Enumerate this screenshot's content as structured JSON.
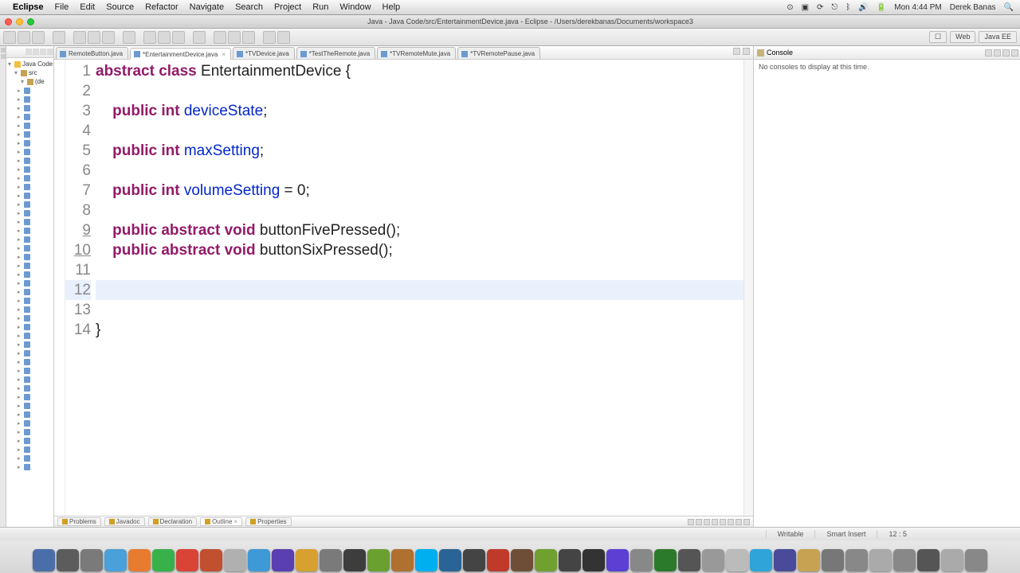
{
  "mac": {
    "app": "Eclipse",
    "menus": [
      "File",
      "Edit",
      "Source",
      "Refactor",
      "Navigate",
      "Search",
      "Project",
      "Run",
      "Window",
      "Help"
    ],
    "time": "Mon 4:44 PM",
    "user": "Derek Banas"
  },
  "window": {
    "title": "Java - Java Code/src/EntertainmentDevice.java - Eclipse - /Users/derekbanas/Documents/workspace3"
  },
  "perspectives": [
    "Web",
    "Java EE"
  ],
  "explorer": {
    "title": "Java Code",
    "pkg": "src",
    "default_pkg": "(de"
  },
  "tabs": [
    {
      "label": "RemoteButton.java",
      "active": false
    },
    {
      "label": "*EntertainmentDevice.java",
      "active": true
    },
    {
      "label": "*TVDevice.java",
      "active": false
    },
    {
      "label": "*TestTheRemote.java",
      "active": false
    },
    {
      "label": "*TVRemoteMute.java",
      "active": false
    },
    {
      "label": "*TVRemotePause.java",
      "active": false
    }
  ],
  "code": {
    "lines": [
      {
        "n": 1,
        "t": [
          [
            "kw",
            "abstract"
          ],
          [
            "sp",
            " "
          ],
          [
            "kw",
            "class"
          ],
          [
            "sp",
            " "
          ],
          [
            "ident",
            "EntertainmentDevice {"
          ]
        ]
      },
      {
        "n": 2,
        "t": []
      },
      {
        "n": 3,
        "t": [
          [
            "sp",
            "    "
          ],
          [
            "kw",
            "public"
          ],
          [
            "sp",
            " "
          ],
          [
            "typekw",
            "int"
          ],
          [
            "sp",
            " "
          ],
          [
            "field",
            "deviceState"
          ],
          [
            "ident",
            ";"
          ]
        ]
      },
      {
        "n": 4,
        "t": []
      },
      {
        "n": 5,
        "t": [
          [
            "sp",
            "    "
          ],
          [
            "kw",
            "public"
          ],
          [
            "sp",
            " "
          ],
          [
            "typekw",
            "int"
          ],
          [
            "sp",
            " "
          ],
          [
            "field",
            "maxSetting"
          ],
          [
            "ident",
            ";"
          ]
        ]
      },
      {
        "n": 6,
        "t": []
      },
      {
        "n": 7,
        "t": [
          [
            "sp",
            "    "
          ],
          [
            "kw",
            "public"
          ],
          [
            "sp",
            " "
          ],
          [
            "typekw",
            "int"
          ],
          [
            "sp",
            " "
          ],
          [
            "field",
            "volumeSetting"
          ],
          [
            "sp",
            " "
          ],
          [
            "ident",
            "= "
          ],
          [
            "num",
            "0"
          ],
          [
            "ident",
            ";"
          ]
        ],
        "hl": false
      },
      {
        "n": 8,
        "t": []
      },
      {
        "n": 9,
        "t": [
          [
            "sp",
            "    "
          ],
          [
            "kw",
            "public"
          ],
          [
            "sp",
            " "
          ],
          [
            "kw",
            "abstract"
          ],
          [
            "sp",
            " "
          ],
          [
            "typekw",
            "void"
          ],
          [
            "sp",
            " "
          ],
          [
            "ident",
            "buttonFivePressed();"
          ]
        ],
        "under": true
      },
      {
        "n": 10,
        "t": [
          [
            "sp",
            "    "
          ],
          [
            "kw",
            "public"
          ],
          [
            "sp",
            " "
          ],
          [
            "kw",
            "abstract"
          ],
          [
            "sp",
            " "
          ],
          [
            "typekw",
            "void"
          ],
          [
            "sp",
            " "
          ],
          [
            "ident",
            "buttonSixPressed();"
          ]
        ],
        "under": true
      },
      {
        "n": 11,
        "t": []
      },
      {
        "n": 12,
        "t": [
          [
            "sp",
            "    "
          ]
        ],
        "current": true
      },
      {
        "n": 13,
        "t": []
      },
      {
        "n": 14,
        "t": [
          [
            "ident",
            "}"
          ]
        ]
      }
    ]
  },
  "console": {
    "title": "Console",
    "msg": "No consoles to display at this time."
  },
  "bottom_views": [
    "Problems",
    "Javadoc",
    "Declaration",
    "Outline",
    "Properties"
  ],
  "status": {
    "writable": "Writable",
    "insert": "Smart Insert",
    "pos": "12 : 5"
  },
  "dock_colors": [
    "#4a6ea9",
    "#5c5c5c",
    "#7a7a7a",
    "#4aa0d8",
    "#e77b2f",
    "#38b14a",
    "#d94436",
    "#c05030",
    "#b0b0b0",
    "#3e99d6",
    "#5a3fb0",
    "#d8a030",
    "#7a7a7a",
    "#3d3d3d",
    "#6aa030",
    "#b07030",
    "#00aff0",
    "#2a6496",
    "#444",
    "#c0392b",
    "#6f4e37",
    "#70a030",
    "#444",
    "#333",
    "#5d3fd3",
    "#888",
    "#2b7a2b",
    "#555",
    "#999",
    "#bbb",
    "#2fa4d8",
    "#4a4a9a",
    "#c7a252",
    "#777",
    "#888",
    "#aaa",
    "#888",
    "#555",
    "#aaa",
    "#888"
  ]
}
